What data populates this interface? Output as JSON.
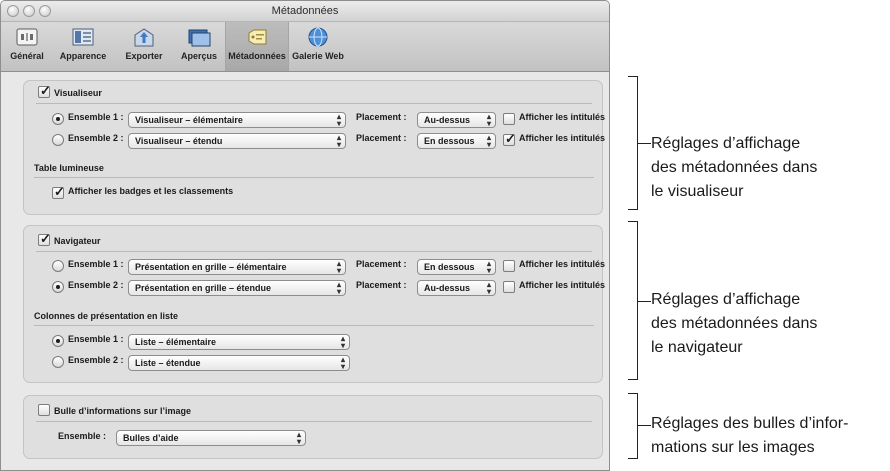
{
  "window": {
    "title": "Métadonnées"
  },
  "toolbar": {
    "items": [
      {
        "label": "Général",
        "icon": "general-switch-icon"
      },
      {
        "label": "Apparence",
        "icon": "appearance-icon"
      },
      {
        "label": "Exporter",
        "icon": "export-icon"
      },
      {
        "label": "Aperçus",
        "icon": "previews-icon"
      },
      {
        "label": "Métadonnées",
        "icon": "metadata-tag-icon",
        "selected": true
      },
      {
        "label": "Galerie Web",
        "icon": "web-gallery-globe-icon"
      }
    ]
  },
  "viewer": {
    "checkbox_label": "Visualiseur",
    "checked": true,
    "set1": {
      "label": "Ensemble 1 :",
      "selected": true,
      "popup": "Visualiseur – élémentaire",
      "placement_label": "Placement :",
      "placement": "Au-dessus",
      "show_labels": "Afficher les intitulés",
      "show_labels_checked": false
    },
    "set2": {
      "label": "Ensemble 2 :",
      "selected": false,
      "popup": "Visualiseur – étendu",
      "placement_label": "Placement :",
      "placement": "En dessous",
      "show_labels": "Afficher les intitulés",
      "show_labels_checked": true
    },
    "lighttable_title": "Table lumineuse",
    "badges_label": "Afficher les badges et les classements",
    "badges_checked": true
  },
  "browser": {
    "checkbox_label": "Navigateur",
    "checked": true,
    "set1": {
      "label": "Ensemble 1 :",
      "selected": false,
      "popup": "Présentation en grille – élémentaire",
      "placement_label": "Placement :",
      "placement": "En dessous",
      "show_labels": "Afficher les intitulés",
      "show_labels_checked": false
    },
    "set2": {
      "label": "Ensemble 2 :",
      "selected": true,
      "popup": "Présentation en grille – étendue",
      "placement_label": "Placement :",
      "placement": "Au-dessus",
      "show_labels": "Afficher les intitulés",
      "show_labels_checked": false
    },
    "columns_title": "Colonnes de présentation en liste",
    "list1": {
      "label": "Ensemble 1 :",
      "selected": true,
      "popup": "Liste – élémentaire"
    },
    "list2": {
      "label": "Ensemble 2 :",
      "selected": false,
      "popup": "Liste – étendue"
    }
  },
  "infobubble": {
    "checkbox_label": "Bulle d’informations sur l’image",
    "checked": false,
    "set_label": "Ensemble :",
    "popup": "Bulles d’aide"
  },
  "annotations": {
    "viewer": [
      "Réglages d’affichage",
      "des métadonnées dans",
      "le visualiseur"
    ],
    "browser": [
      "Réglages d’affichage",
      "des métadonnées dans",
      "le navigateur"
    ],
    "bubbles": [
      "Réglages des bulles d’infor-",
      "mations sur les images"
    ]
  }
}
